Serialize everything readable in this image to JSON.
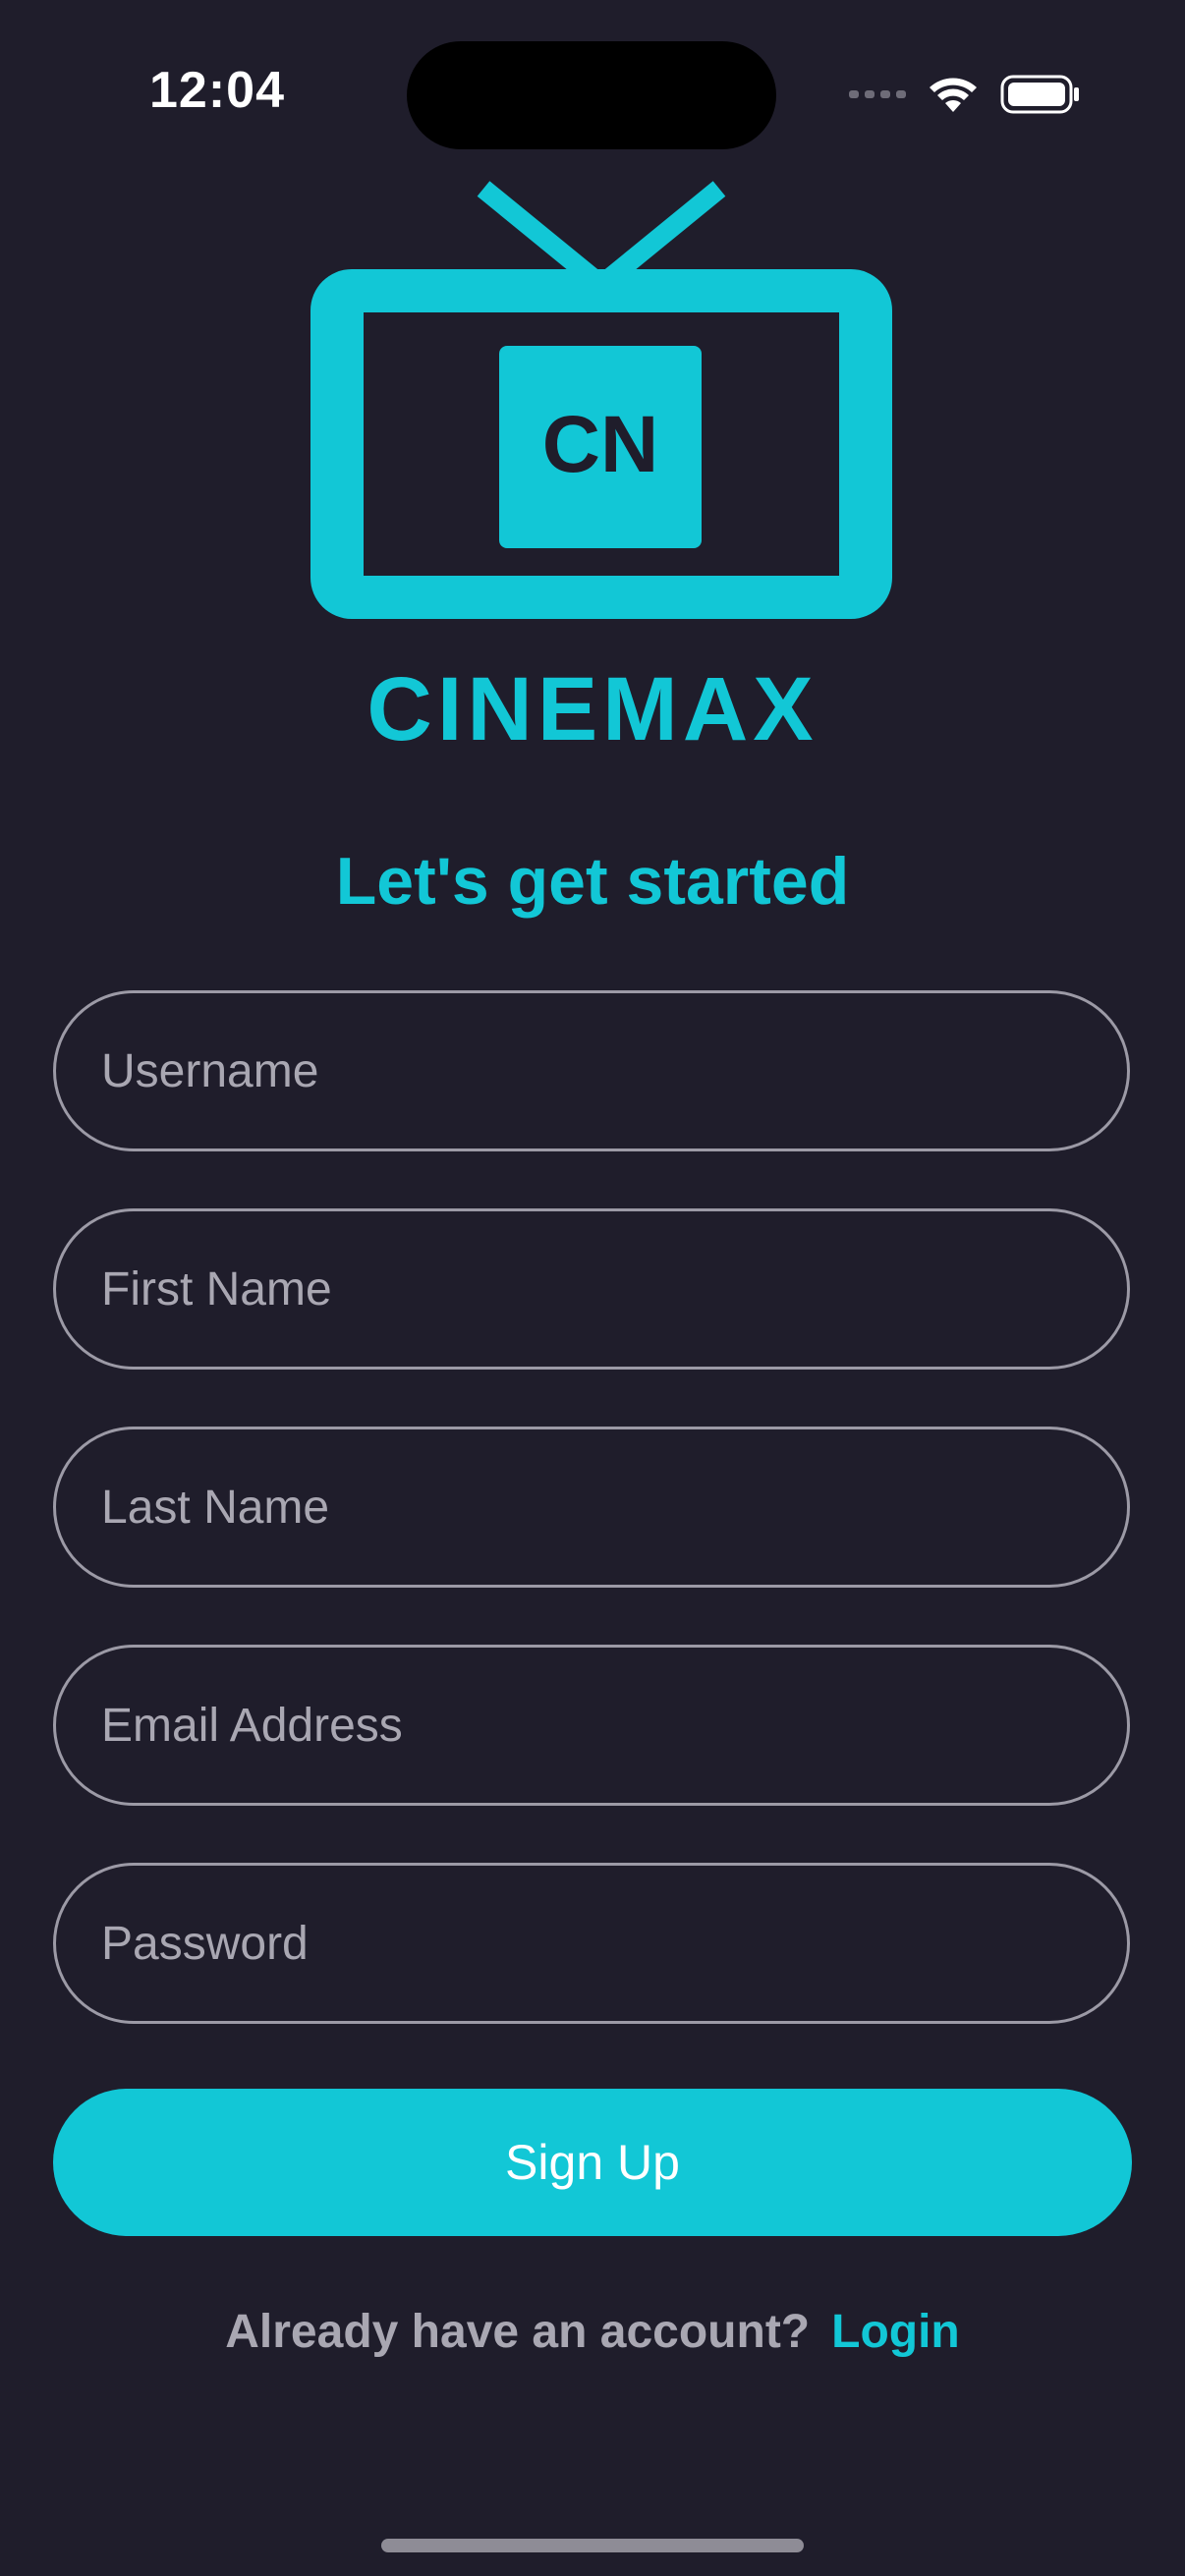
{
  "status_bar": {
    "time": "12:04",
    "icons": [
      "cellular-signal-icon",
      "wifi-icon",
      "battery-icon"
    ]
  },
  "logo": {
    "monogram": "CN",
    "brand_name": "CINEMAX"
  },
  "heading": "Let's get started",
  "form": {
    "username_placeholder": "Username",
    "first_name_placeholder": "First Name",
    "last_name_placeholder": "Last Name",
    "email_placeholder": "Email Address",
    "password_placeholder": "Password",
    "signup_label": "Sign Up"
  },
  "footer": {
    "prompt": "Already have an account?",
    "login_label": "Login"
  },
  "colors": {
    "background": "#1f1d2b",
    "accent": "#12c7d6",
    "muted_text": "#a9a7b2",
    "field_border": "#9c9aa6"
  }
}
